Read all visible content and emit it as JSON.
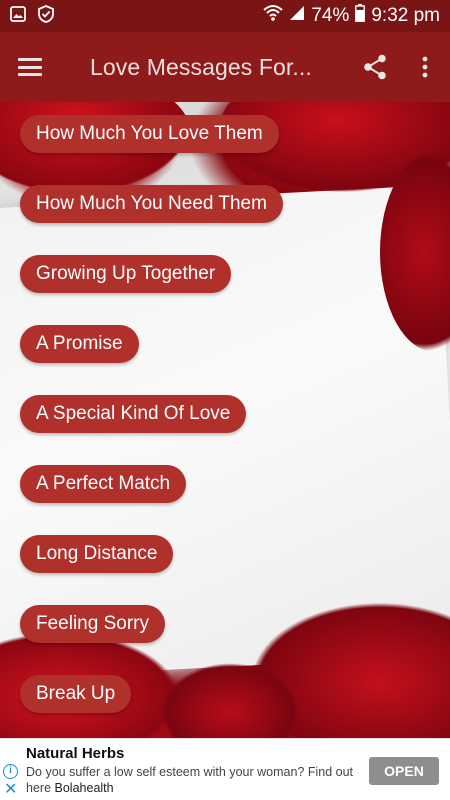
{
  "status_bar": {
    "battery": "74%",
    "time": "9:32 pm",
    "icons": [
      "gallery-icon",
      "shield-check-icon",
      "wifi-icon",
      "signal-icon",
      "battery-icon"
    ]
  },
  "app_bar": {
    "title": "Love Messages For...",
    "menu_icon": "hamburger-icon",
    "share_icon": "share-icon",
    "overflow_icon": "more-vert-icon"
  },
  "categories": [
    "How Much You Love Them",
    "How Much You Need Them",
    "Growing Up Together",
    "A Promise",
    "A Special Kind Of Love",
    "A Perfect Match",
    "Long Distance",
    "Feeling Sorry",
    "Break Up"
  ],
  "ad": {
    "title": "Natural Herbs",
    "text": "Do you suffer a low self esteem with your woman? Find out here",
    "sponsor": "Bolahealth",
    "button": "OPEN",
    "info_icon": "info-icon",
    "close_icon": "close-icon"
  },
  "colors": {
    "status_bar": "#7a1515",
    "app_bar": "#8e1a1a",
    "chip": "#b0302b",
    "ad_button": "#8e8e8e"
  }
}
